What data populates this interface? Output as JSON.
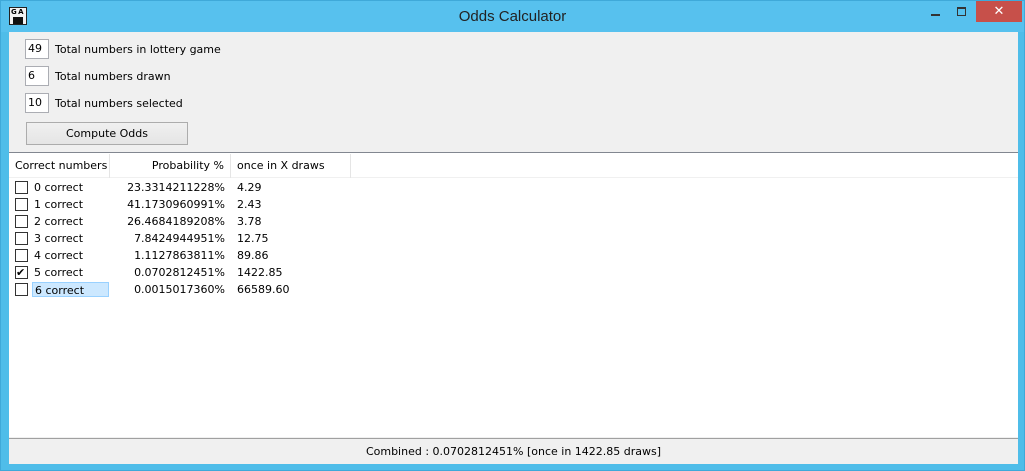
{
  "window": {
    "title": "Odds Calculator",
    "close_label": "✕"
  },
  "params": {
    "total_numbers": {
      "value": "49",
      "label": "Total numbers in lottery game"
    },
    "numbers_drawn": {
      "value": "6",
      "label": "Total numbers drawn"
    },
    "numbers_selected": {
      "value": "10",
      "label": "Total numbers selected"
    }
  },
  "compute_button": "Compute Odds",
  "table": {
    "columns": [
      "Correct numbers",
      "Probability %",
      "once in X draws"
    ],
    "rows": [
      {
        "label": "0 correct",
        "checked": false,
        "probability": "23.3314211228%",
        "once_in": "4.29"
      },
      {
        "label": "1 correct",
        "checked": false,
        "probability": "41.1730960991%",
        "once_in": "2.43"
      },
      {
        "label": "2 correct",
        "checked": false,
        "probability": "26.4684189208%",
        "once_in": "3.78"
      },
      {
        "label": "3 correct",
        "checked": false,
        "probability": "7.8424944951%",
        "once_in": "12.75"
      },
      {
        "label": "4 correct",
        "checked": false,
        "probability": "1.1127863811%",
        "once_in": "89.86"
      },
      {
        "label": "5 correct",
        "checked": true,
        "probability": "0.0702812451%",
        "once_in": "1422.85"
      },
      {
        "label": "6 correct",
        "checked": false,
        "probability": "0.0015017360%",
        "once_in": "66589.60"
      }
    ]
  },
  "status": "Combined : 0.0702812451% [once in 1422.85 draws]"
}
